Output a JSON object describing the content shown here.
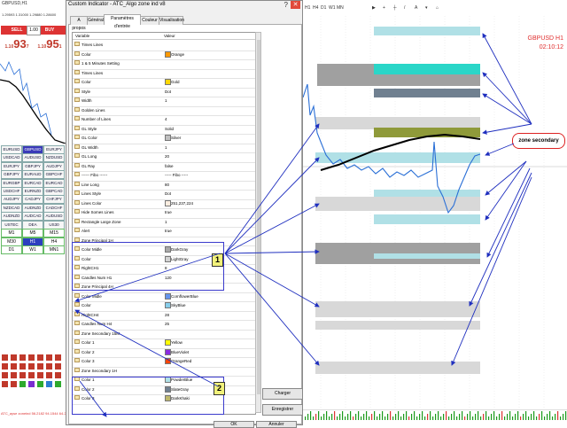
{
  "left_panel": {
    "title": "GBPUSD,H1",
    "subtitle": "1.29593 1.31000 1.29880 1.28600",
    "sell_label": "SELL",
    "buy_label": "BUY",
    "lot": "1.00",
    "sell_big": "93",
    "sell_pre": "1.10",
    "sell_sup": "7",
    "buy_big": "95",
    "buy_pre": "1.10",
    "buy_sup": "1",
    "pairs": [
      "EURUSD",
      "GBPUSD",
      "EURJPY",
      "USDCAD",
      "AUDUSD",
      "NZDUSD",
      "EURJPY",
      "GBPJPY",
      "AUDJPY",
      "GBPJPY",
      "EURAUD",
      "GBPCHF",
      "EURGBP",
      "EURCAD",
      "EURCAD",
      "USDCHF",
      "EURNZD",
      "GBPCAD",
      "AUDJPY",
      "CADJPY",
      "CHFJPY",
      "NZDCAD",
      "AUDNZD",
      "CADCHF",
      "AUDNZD",
      "AUDCAD",
      "AUDUSD",
      "USTEC",
      "DEA",
      "US30"
    ],
    "timeframes": [
      "M1",
      "M5",
      "M15",
      "M30",
      "H1",
      "H4",
      "D1",
      "W1",
      "MN1"
    ],
    "bottom_text": "ATC_ayse zoneind 56.2182 94.1544 64.2399"
  },
  "dialog": {
    "caption": "Custom Indicator - ATC_Algo zone ind v8",
    "help": "?",
    "close": "✕",
    "tabs": [
      "A propos",
      "Général",
      "Paramètres d'entrée",
      "Couleur",
      "Visualisation"
    ],
    "active_tab": 2,
    "col_variable": "Variable",
    "col_value": "Valeur",
    "buttons": {
      "charger": "Charger",
      "enregistrer": "Enregistrer",
      "ok": "OK",
      "annuler": "Annuler"
    },
    "rows": [
      {
        "name": "Times Lines",
        "value": "",
        "swatch": ""
      },
      {
        "name": "Color",
        "value": "Orange",
        "swatch": "#ff9900"
      },
      {
        "name": "1 & 5 Minutes Setting",
        "value": "",
        "swatch": ""
      },
      {
        "name": "Times Lines",
        "value": "",
        "swatch": ""
      },
      {
        "name": "    Color",
        "value": "Gold",
        "swatch": "#ffd700"
      },
      {
        "name": "    Style",
        "value": "Dot",
        "swatch": ""
      },
      {
        "name": "    Width",
        "value": "1",
        "swatch": ""
      },
      {
        "name": "Golden Lines",
        "value": "",
        "swatch": ""
      },
      {
        "name": "    Number of Lines",
        "value": "4",
        "swatch": ""
      },
      {
        "name": "    GL Style",
        "value": "Solid",
        "swatch": ""
      },
      {
        "name": "    GL Color",
        "value": "Silver",
        "swatch": "#c0c0c0"
      },
      {
        "name": "    GL Width",
        "value": "1",
        "swatch": ""
      },
      {
        "name": "    GL Long",
        "value": "20",
        "swatch": ""
      },
      {
        "name": "    GL Ray",
        "value": "false",
        "swatch": ""
      },
      {
        "name": "------ Fibo ------",
        "value": "----- Fibo -----",
        "swatch": ""
      },
      {
        "name": "Line Long",
        "value": "80",
        "swatch": ""
      },
      {
        "name": "Lines Style",
        "value": "Dot",
        "swatch": ""
      },
      {
        "name": "Lines Color",
        "value": "251,237,224",
        "swatch": "#fbede0"
      },
      {
        "name": "Hide Somes Lines",
        "value": "true",
        "swatch": ""
      },
      {
        "name": "Rectangle Large Zone",
        "value": "1",
        "swatch": ""
      },
      {
        "name": "Alert",
        "value": "true",
        "swatch": ""
      },
      {
        "name": "Zone Principal 1H",
        "value": "",
        "swatch": ""
      },
      {
        "name": "    Color Midle",
        "value": "DarkGray",
        "swatch": "#a9a9a9"
      },
      {
        "name": "    Color",
        "value": "LightGray",
        "swatch": "#d3d3d3"
      },
      {
        "name": "RightCH1",
        "value": "8",
        "swatch": ""
      },
      {
        "name": "Candles Num H1",
        "value": "120",
        "swatch": ""
      },
      {
        "name": "Zone Principal 4H",
        "value": "",
        "swatch": ""
      },
      {
        "name": "    Color Midle",
        "value": "CornflowerBlue",
        "swatch": "#6495ed"
      },
      {
        "name": "    Color",
        "value": "SkyBlue",
        "swatch": "#87ceeb"
      },
      {
        "name": "RightCH4",
        "value": "28",
        "swatch": ""
      },
      {
        "name": "Candles Num H4",
        "value": "25",
        "swatch": ""
      },
      {
        "name": "Zone Secondary 15M",
        "value": "",
        "swatch": ""
      },
      {
        "name": "    Color 1",
        "value": "Yellow",
        "swatch": "#ffff00"
      },
      {
        "name": "    Color 2",
        "value": "BlueViolet",
        "swatch": "#8a2be2"
      },
      {
        "name": "    Color 3",
        "value": "OrangeRed",
        "swatch": "#ff4500"
      },
      {
        "name": "Zone Secondary 1H",
        "value": "",
        "swatch": ""
      },
      {
        "name": "    Color 1",
        "value": "PowderBlue",
        "swatch": "#b0e0e6"
      },
      {
        "name": "    Color 2",
        "value": "SlateGray",
        "swatch": "#708090"
      },
      {
        "name": "    Color 3",
        "value": "DarkKhaki",
        "swatch": "#bdb76b"
      }
    ],
    "tag1": "1",
    "tag2": "2"
  },
  "chart": {
    "symbol": "GBPUSD H1",
    "time": "02:10:12",
    "zone_secondary_label": "zone secondary",
    "timeframes": [
      "H1",
      "H4",
      "D1",
      "W1",
      "MN"
    ],
    "colors": {
      "powderblue": "#b0e0e6",
      "turquoise": "#2ad6c8",
      "slategray": "#708090",
      "darkkhaki": "#8f9a3a",
      "darkgray": "#a0a0a0",
      "lightgray": "#d8d8d8",
      "arrow": "#1f2fbf"
    }
  }
}
